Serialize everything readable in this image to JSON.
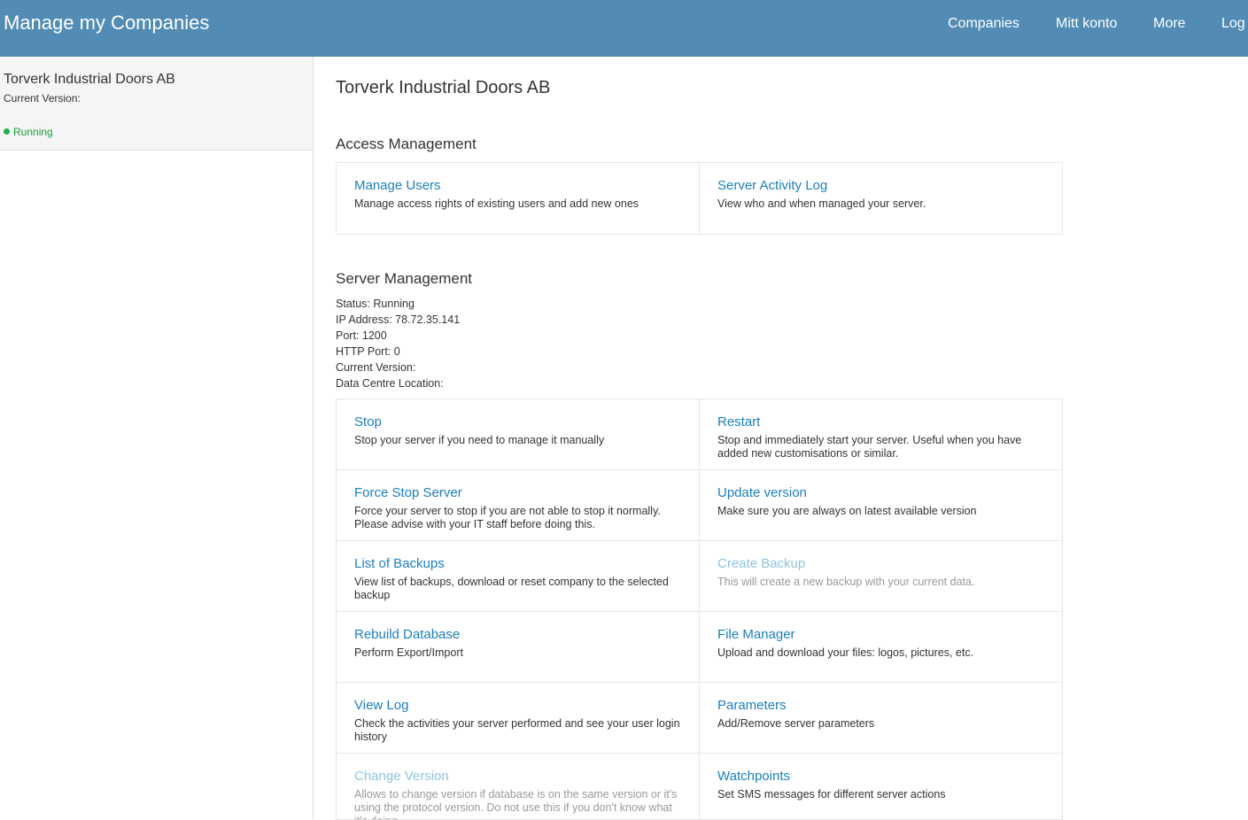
{
  "header": {
    "brand": "Manage my Companies",
    "nav": [
      "Companies",
      "Mitt konto",
      "More",
      "Log"
    ]
  },
  "sidebar": {
    "company_name": "Torverk Industrial Doors AB",
    "current_version_label": "Current Version:",
    "status": "Running",
    "status_color": "#21b14a"
  },
  "main": {
    "title": "Torverk Industrial Doors AB",
    "access_management": {
      "heading": "Access Management",
      "items": [
        {
          "title": "Manage Users",
          "desc": "Manage access rights of existing users and add new ones"
        },
        {
          "title": "Server Activity Log",
          "desc": "View who and when managed your server."
        }
      ]
    },
    "server_management": {
      "heading": "Server Management",
      "info": [
        "Status: Running",
        "IP Address: 78.72.35.141",
        "Port: 1200",
        "HTTP Port: 0",
        "Current Version:",
        "Data Centre Location:"
      ],
      "items": [
        {
          "title": "Stop",
          "desc": "Stop your server if you need to manage it manually"
        },
        {
          "title": "Restart",
          "desc": "Stop and immediately start your server. Useful when you have added new customisations or similar."
        },
        {
          "title": "Force Stop Server",
          "desc": "Force your server to stop if you are not able to stop it normally. Please advise with your IT staff before doing this."
        },
        {
          "title": "Update version",
          "desc": "Make sure you are always on latest available version"
        },
        {
          "title": "List of Backups",
          "desc": "View list of backups, download or reset company to the selected backup"
        },
        {
          "title": "Create Backup",
          "desc": "This will create a new backup with your current data."
        },
        {
          "title": "Rebuild Database",
          "desc": "Perform Export/Import"
        },
        {
          "title": "File Manager",
          "desc": "Upload and download your files: logos, pictures, etc."
        },
        {
          "title": "View Log",
          "desc": "Check the activities your server performed and see your user login history"
        },
        {
          "title": "Parameters",
          "desc": "Add/Remove server parameters"
        },
        {
          "title": "Change Version",
          "desc": "Allows to change version if database is on the same version or it's using the protocol version. Do not use this if you don't know what it's doing."
        },
        {
          "title": "Watchpoints",
          "desc": "Set SMS messages for different server actions"
        }
      ]
    }
  },
  "colors": {
    "header_bg": "#528bb3",
    "link": "#1b7fbd",
    "link_disabled": "#8fc3de"
  }
}
